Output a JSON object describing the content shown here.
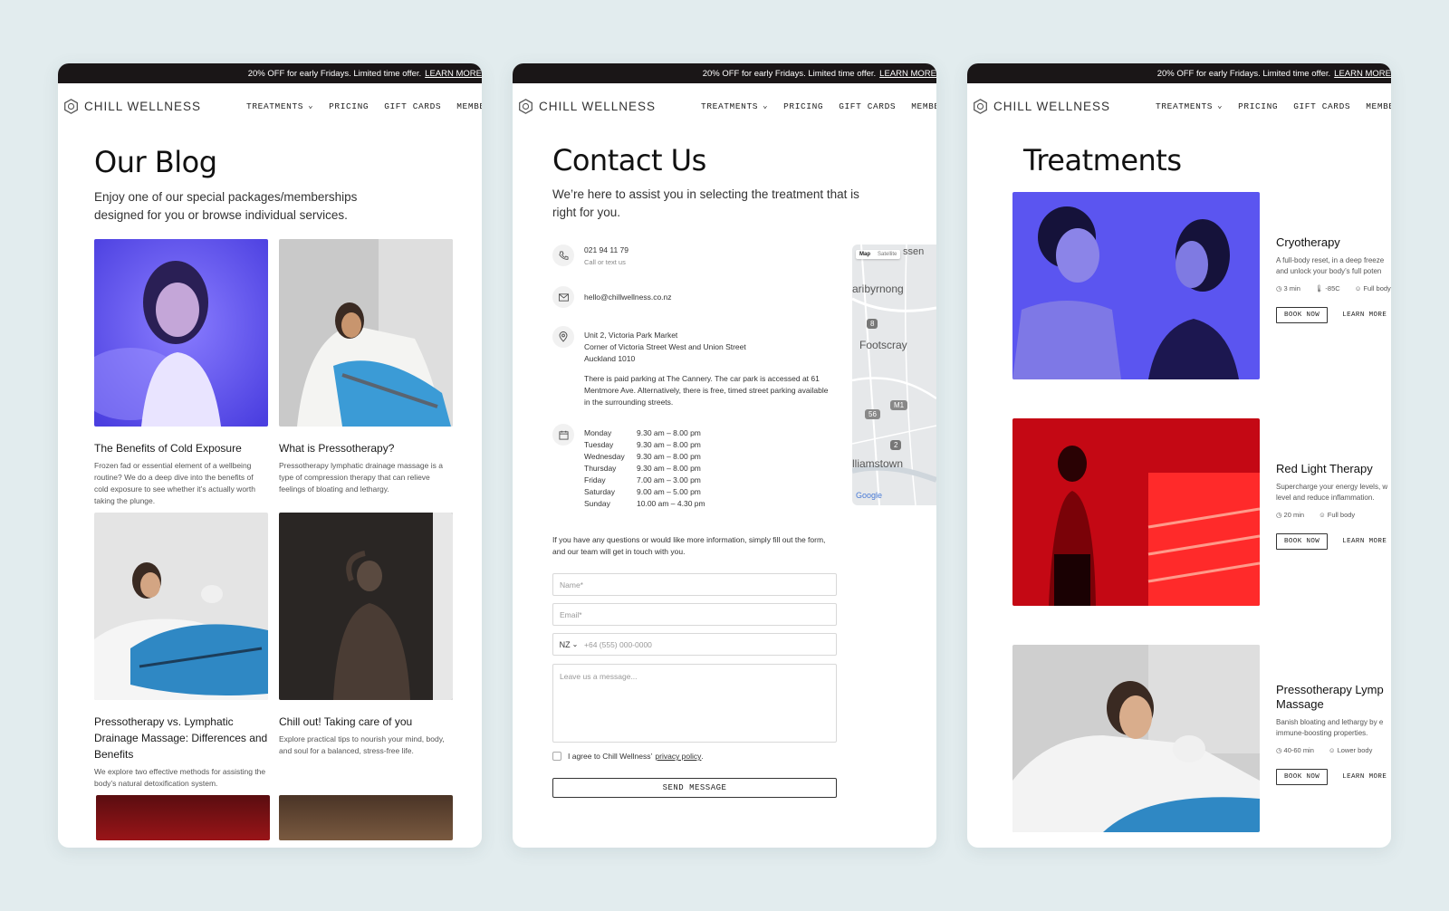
{
  "common": {
    "promo_text": "20% OFF for early Fridays. Limited time offer.",
    "promo_link": "LEARN MORE",
    "logo_text": "CHILL WELLNESS",
    "nav": [
      "TREATMENTS",
      "PRICING",
      "GIFT CARDS",
      "MEMBERSHIPS"
    ]
  },
  "blog": {
    "title": "Our Blog",
    "intro_line1": "Enjoy one of our special packages/memberships",
    "intro_line2": "designed for you or browse individual services.",
    "posts": [
      {
        "title": "The Benefits of Cold Exposure",
        "desc": "Frozen fad or essential element of a wellbeing routine? We do a deep dive into the benefits of cold exposure to see whether it’s actually worth taking the plunge."
      },
      {
        "title": "What is Pressotherapy?",
        "desc": "Pressotherapy lymphatic drainage massage is a type of compression therapy that can relieve feelings of bloating and lethargy."
      },
      {
        "title": "Pressotherapy vs. Lymphatic Drainage Massage: Differences and Benefits",
        "desc": "We explore two effective methods for assisting the body’s natural detoxification system."
      },
      {
        "title": "Chill out! Taking care of you",
        "desc": "Explore practical tips to nourish your mind, body, and soul for a balanced, stress-free life."
      }
    ]
  },
  "contact": {
    "title": "Contact Us",
    "intro_line1": "We’re here to assist you in selecting the treatment that is",
    "intro_line2": "right for you.",
    "phone": "021 94 11 79",
    "phone_sub": "Call or text us",
    "email": "hello@chillwellness.co.nz",
    "address_line1": "Unit 2, Victoria Park Market",
    "address_line2": "Corner of Victoria Street West and Union Street",
    "address_line3": "Auckland 1010",
    "parking_line1": "There is paid parking at The Cannery. The car park is accessed at 61",
    "parking_line2": "Mentmore Ave. Alternatively, there is free, timed street parking available",
    "parking_line3": "in the surrounding streets.",
    "hours": [
      {
        "day": "Monday",
        "time": "9.30 am – 8.00 pm"
      },
      {
        "day": "Tuesday",
        "time": "9.30 am – 8.00 pm"
      },
      {
        "day": "Wednesday",
        "time": "9.30 am – 8.00 pm"
      },
      {
        "day": "Thursday",
        "time": "9.30 am – 8.00 pm"
      },
      {
        "day": "Friday",
        "time": "7.00 am – 3.00 pm"
      },
      {
        "day": "Saturday",
        "time": "9.00 am – 5.00 pm"
      },
      {
        "day": "Sunday",
        "time": "10.00 am – 4.30 pm"
      }
    ],
    "map": {
      "tab_map": "Map",
      "tab_satellite": "Satellite",
      "label_top": "ssen",
      "label_1": "aribyrnong",
      "label_2": "Footscray",
      "label_3": "lliamstown",
      "badge_8": "8",
      "badge_56": "56",
      "badge_m1": "M1",
      "badge_2": "2",
      "google": "Google"
    },
    "form_intro_line1": "If you have any questions or would like more information, simply fill out the form,",
    "form_intro_line2": "and our team will get in touch with you.",
    "name_placeholder": "Name*",
    "email_placeholder": "Email*",
    "country_code": "NZ",
    "phone_placeholder": "+64 (555) 000-0000",
    "message_placeholder": "Leave us a message...",
    "agree_text": "I agree to Chill Wellness’",
    "privacy_link": "privacy policy",
    "agree_end": ".",
    "send_label": "SEND MESSAGE"
  },
  "treatments": {
    "title": "Treatments",
    "items": [
      {
        "name": "Cryotherapy",
        "desc_line1": "A full-body reset, in a deep freeze",
        "desc_line2": "and unlock your body’s full poten",
        "meta": [
          "3 min",
          "-85C",
          "Full body"
        ],
        "book": "BOOK NOW",
        "learn": "LEARN MORE"
      },
      {
        "name": "Red Light Therapy",
        "desc_line1": "Supercharge your energy levels, w",
        "desc_line2": "level and reduce inflammation.",
        "meta": [
          "20 min",
          "Full body"
        ],
        "book": "BOOK NOW",
        "learn": "LEARN MORE"
      },
      {
        "name_line1": "Pressotherapy Lymp",
        "name_line2": "Massage",
        "desc_line1": "Banish bloating and lethargy by e",
        "desc_line2": "immune-boosting properties.",
        "meta": [
          "40-60 min",
          "Lower body"
        ],
        "book": "BOOK NOW",
        "learn": "LEARN MORE"
      }
    ]
  }
}
